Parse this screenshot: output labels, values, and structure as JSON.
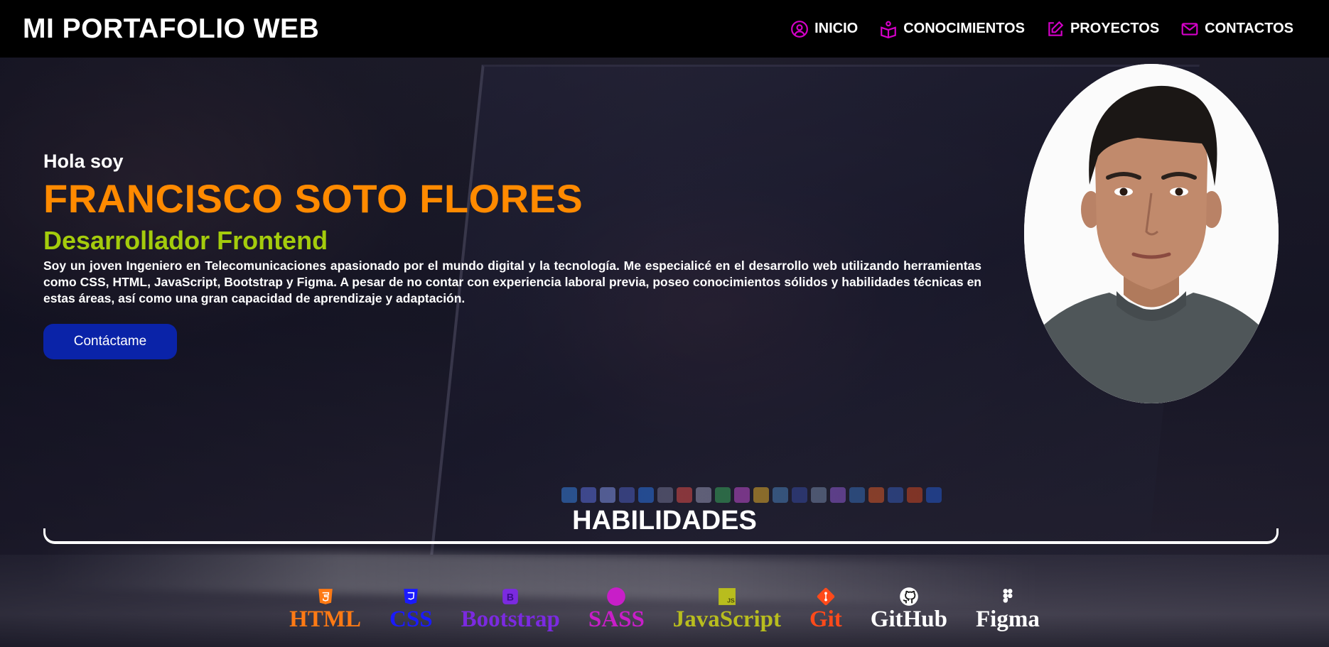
{
  "header": {
    "brand": "MI PORTAFOLIO WEB",
    "nav": [
      {
        "label": "INICIO",
        "icon": "user-circle-icon"
      },
      {
        "label": "CONOCIMIENTOS",
        "icon": "book-icon"
      },
      {
        "label": "PROYECTOS",
        "icon": "edit-icon"
      },
      {
        "label": "CONTACTOS",
        "icon": "mail-icon"
      }
    ],
    "accent": "#d400c8"
  },
  "hero": {
    "greeting": "Hola soy",
    "name": "FRANCISCO SOTO FLORES",
    "role": "Desarrollador Frontend",
    "bio": "Soy un joven Ingeniero en Telecomunicaciones apasionado por el mundo digital y la tecnología. Me especialicé en el desarrollo web utilizando herramientas como CSS, HTML, JavaScript, Bootstrap y Figma. A pesar de no contar con experiencia laboral previa, poseo conocimientos sólidos y habilidades técnicas en estas áreas, así como una gran capacidad de aprendizaje y adaptación.",
    "cta_label": "Contáctame",
    "colors": {
      "name": "#ff8a00",
      "role": "#a4cc0c",
      "cta": "#0a23a8"
    }
  },
  "skills": {
    "title": "HABILIDADES",
    "items": [
      {
        "label": "HTML",
        "icon": "html5-icon",
        "color": "#ff7a14"
      },
      {
        "label": "CSS",
        "icon": "css3-icon",
        "color": "#1a1aff"
      },
      {
        "label": "Bootstrap",
        "icon": "bootstrap-icon",
        "color": "#7b2ae0"
      },
      {
        "label": "SASS",
        "icon": "sass-icon",
        "color": "#c81ec8"
      },
      {
        "label": "JavaScript",
        "icon": "javascript-icon",
        "color": "#b8bd1e"
      },
      {
        "label": "Git",
        "icon": "git-icon",
        "color": "#ff4a1a"
      },
      {
        "label": "GitHub",
        "icon": "github-icon",
        "color": "#ffffff"
      },
      {
        "label": "Figma",
        "icon": "figma-icon",
        "color": "#ffffff"
      }
    ]
  }
}
